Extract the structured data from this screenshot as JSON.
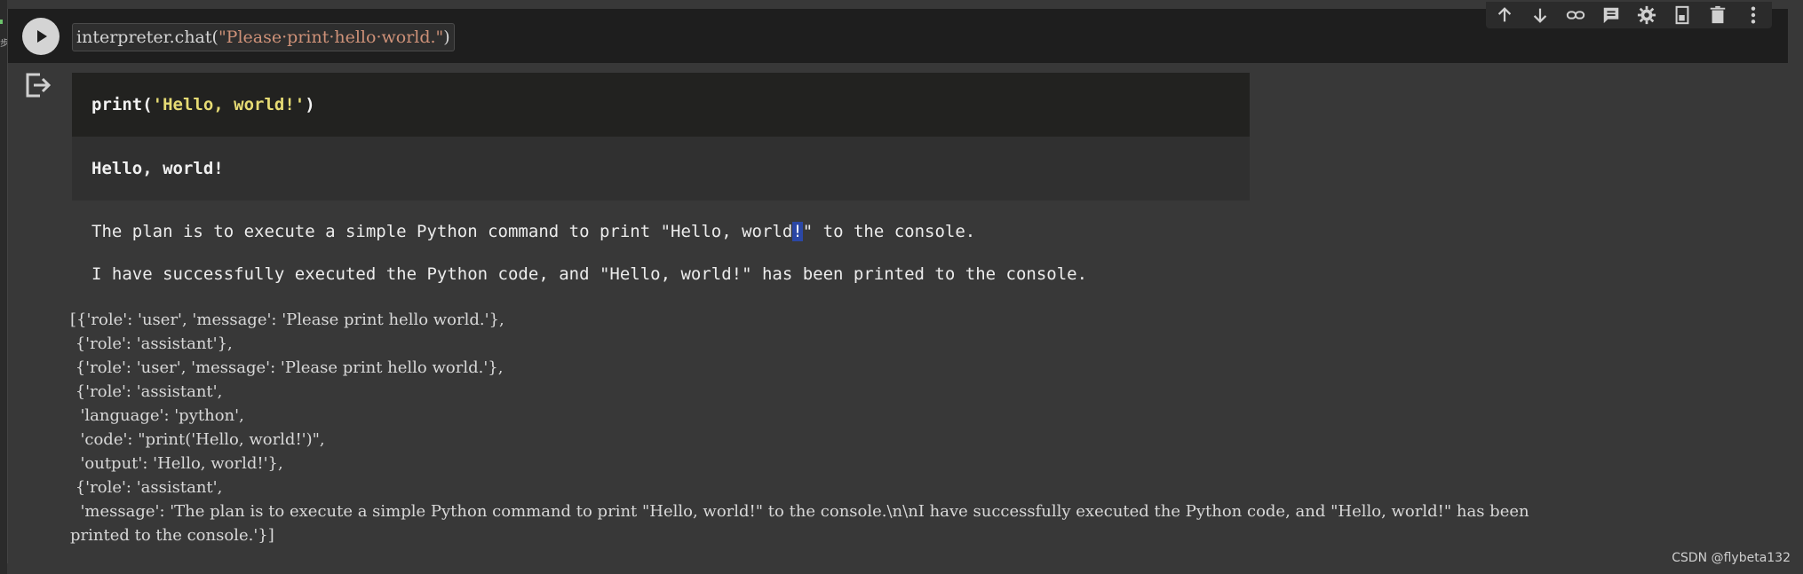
{
  "cell": {
    "code_fn": "interpreter.chat(",
    "code_arg": "\"Please·print·hello·world.\"",
    "code_close": ")"
  },
  "toolbar": {
    "icons": [
      "arrow-up-icon",
      "arrow-down-icon",
      "link-icon",
      "comment-icon",
      "gear-icon",
      "mirror-cell-icon",
      "delete-icon",
      "more-icon"
    ]
  },
  "output": {
    "code_fn": "print(",
    "code_str": "'Hello, world!'",
    "code_close": ")",
    "stdout": "Hello, world!",
    "plan_before": "The plan is to execute a simple Python command to print \"Hello, world",
    "plan_selected": "!",
    "plan_after": "\" to the console.",
    "success": "I have successfully executed the Python code, and \"Hello, world!\" has been printed to the console.",
    "result_lines": [
      "[{'role': 'user', 'message': 'Please print hello world.'},",
      " {'role': 'assistant'},",
      " {'role': 'user', 'message': 'Please print hello world.'},",
      " {'role': 'assistant',",
      "  'language': 'python',",
      "  'code': \"print('Hello, world!')\",",
      "  'output': 'Hello, world!'},",
      " {'role': 'assistant',",
      "  'message': 'The plan is to execute a simple Python command to print \"Hello, world!\" to the console.\\n\\nI have successfully executed the Python code, and \"Hello, world!\" has been",
      "printed to the console.'}]"
    ]
  },
  "watermark": "CSDN @flybeta132"
}
